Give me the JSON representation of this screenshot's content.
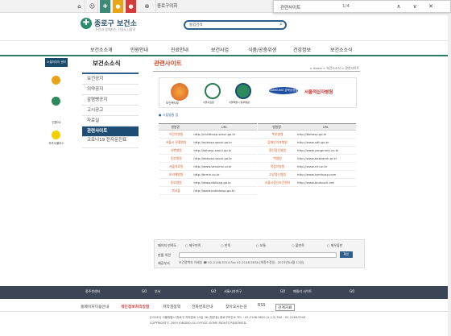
{
  "util": {
    "council_label": "종로구의회"
  },
  "find": {
    "query": "관련사이트",
    "count": "1/4",
    "up": "∧",
    "down": "∨",
    "close": "✕"
  },
  "header": {
    "logo_title": "종로구 보건소",
    "logo_sub": "주민과 함께하는 건강도시종로",
    "search_select": "통합검색"
  },
  "gnb": [
    "보건소소개",
    "민원안내",
    "진료안내",
    "보건사업",
    "식품/공중위생",
    "건강정보",
    "보건소소식"
  ],
  "side": {
    "title": "소셜미디어 센터",
    "items": [
      "블로그",
      "민원24",
      "카카오플러스"
    ]
  },
  "lnb": {
    "title": "보건소소식",
    "items": [
      "보건공지",
      "의약공지",
      "감염병공지",
      "고시공고",
      "자료실",
      "관련사이트",
      "코로나19 전자문진표"
    ]
  },
  "page": {
    "title": "관련사이트",
    "crumb": "⌂ Home > 보건소소식 > 관련사이트",
    "related_heading": "● 시립병원 등"
  },
  "logos": {
    "bokji": "보건복지부",
    "seoul_med": "서울의료원",
    "dongbu": "서울특별시 동부병원",
    "samsung": "SAMSUNG 강북삼성병원",
    "redcross": "서울적십자병원"
  },
  "table_a": {
    "h1": "병원명",
    "h2": "URL",
    "rows": [
      {
        "n": "어린이병원",
        "u": "http://childhosp.seoul.go.kr"
      },
      {
        "n": "서울시 은평병원",
        "u": "http://ephosp.seoul.go.kr"
      },
      {
        "n": "서북병원",
        "u": "http://sbhosp.seoul.go.kr"
      },
      {
        "n": "동부병원",
        "u": "http://ebhosp.seoul.go.kr"
      },
      {
        "n": "서울의료원",
        "u": "http://www.seoulmc.or.kr"
      },
      {
        "n": "보라매병원",
        "u": "http://brmh.co.kr"
      },
      {
        "n": "동부병원",
        "u": "http://www.dbhosp.go.kr"
      },
      {
        "n": "북서울",
        "u": "http://www.bukbhosp.go.kr"
      }
    ]
  },
  "table_b": {
    "h1": "병원명",
    "h2": "URL",
    "rows": [
      {
        "n": "북부병원",
        "u": "http://bbhosp.go.kr"
      },
      {
        "n": "장애인치과병원",
        "u": "http://www.sdh.go.kr"
      },
      {
        "n": "용인정신병원",
        "u": "http://www.yonginmh.co.kr"
      },
      {
        "n": "백병원",
        "u": "http://www.baekamh.or.kr"
      },
      {
        "n": "적십자병원",
        "u": "http://www.rch.or.kr"
      },
      {
        "n": "고양정신병원",
        "u": "http://www.kymhosp.com"
      },
      {
        "n": "서울시정신보건센터",
        "u": "http://www.blutouch.net"
      }
    ]
  },
  "eval": {
    "q_label": "페이지 만족도",
    "opts": [
      "매우만족",
      "만족",
      "보통",
      "불만족",
      "매우불만"
    ],
    "opinion_label": "한줄 의견",
    "submit": "확인",
    "dept_label": "제공부서",
    "dept": "보건정책과 이혜승 ☎ 02-2148-5514 Fax 02-2148-5838 [최종수정일 : 2023년04월 11일]"
  },
  "quick": [
    {
      "l": "종주한센터",
      "g": "GO"
    },
    {
      "l": "부서",
      "g": "GO"
    },
    {
      "l": "서울시자치구",
      "g": "GO"
    },
    {
      "l": "패밀리 사이트",
      "g": "GO"
    }
  ],
  "fnav": [
    "홈페이지이용안내",
    "개인정보처리방침",
    "저작권정책",
    "전화번호안내",
    "찾아오시는길",
    "RSS",
    "관계자료"
  ],
  "footer": {
    "line1": "[03140] 서울특별시 종로구 자하문로 19길 36 (청운동) 종로구보건소  TEL : 02-2148-3620 (1,2,3)  FAX : 02-2148-5943",
    "line2": "COPYRIGHT© 2009 JONGNO-GU OFFICE. SOME RIGHTS RESERVED."
  }
}
